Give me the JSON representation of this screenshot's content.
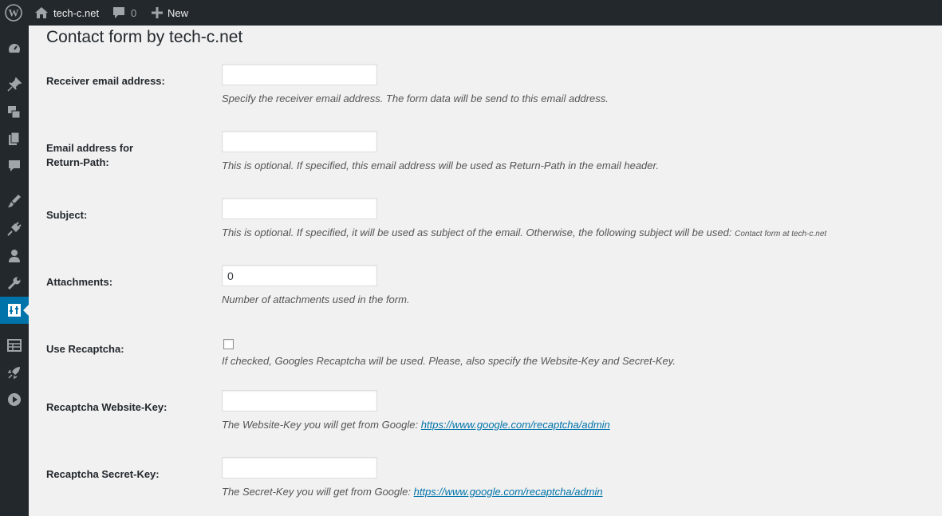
{
  "admin_bar": {
    "site_name": "tech-c.net",
    "comments_count": "0",
    "new_label": "New"
  },
  "page": {
    "title": "Contact form by tech-c.net"
  },
  "fields": {
    "receiver": {
      "label": "Receiver email address:",
      "value": "",
      "description": "Specify the receiver email address. The form data will be send to this email address."
    },
    "return_path": {
      "label_line1": "Email address for",
      "label_line2": "Return-Path:",
      "value": "",
      "description": "This is optional. If specified, this email address will be used as Return-Path in the email header."
    },
    "subject": {
      "label": "Subject:",
      "value": "",
      "description": "This is optional. If specified, it will be used as subject of the email. Otherwise, the following subject will be used:",
      "default_subject": "Contact form at tech-c.net"
    },
    "attachments": {
      "label": "Attachments:",
      "value": "0",
      "description": "Number of attachments used in the form."
    },
    "use_recaptcha": {
      "label": "Use Recaptcha:",
      "checked": false,
      "description": "If checked, Googles Recaptcha will be used. Please, also specify the Website-Key and Secret-Key."
    },
    "website_key": {
      "label": "Recaptcha Website-Key:",
      "value": "",
      "description": "The Website-Key you will get from Google:",
      "link": "https://www.google.com/recaptcha/admin"
    },
    "secret_key": {
      "label": "Recaptcha Secret-Key:",
      "value": "",
      "description": "The Secret-Key you will get from Google:",
      "link": "https://www.google.com/recaptcha/admin"
    }
  },
  "sidebar_icons": [
    "dashboard-icon",
    "pin-icon",
    "media-icon",
    "pages-icon",
    "comments-icon",
    "appearance-icon",
    "plugins-icon",
    "users-icon",
    "tools-icon",
    "settings-icon",
    "table-icon",
    "rocket-icon",
    "play-icon"
  ],
  "colors": {
    "admin_bar_bg": "#23282d",
    "accent": "#0073aa",
    "page_bg": "#f1f1f1"
  }
}
